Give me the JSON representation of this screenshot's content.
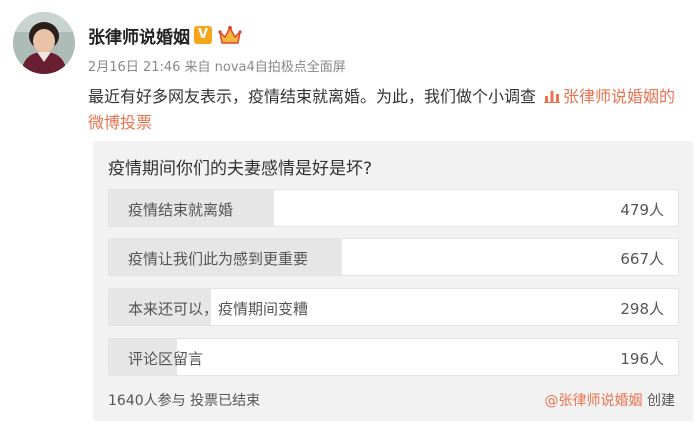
{
  "post": {
    "author_name": "张律师说婚姻",
    "verified_label": "V",
    "meta": "2月16日 21:46 来自 nova4自拍极点全面屏",
    "text": "最近有好多网友表示，疫情结束就离婚。为此，我们做个小调查",
    "poll_link_text": "张律师说婚姻的微博投票",
    "accent_color": "#eb7350"
  },
  "poll": {
    "question": "疫情期间你们的夫妻感情是好是坏?",
    "options": [
      {
        "label": "疫情结束就离婚",
        "count": "479人",
        "share": 0.29
      },
      {
        "label": "疫情让我们此为感到更重要",
        "count": "667人",
        "share": 0.41
      },
      {
        "label": "本来还可以，疫情期间变糟",
        "count": "298人",
        "share": 0.18
      },
      {
        "label": "评论区留言",
        "count": "196人",
        "share": 0.12
      }
    ],
    "status": "1640人参与 投票已结束",
    "creator_handle": "@张律师说婚姻",
    "creator_suffix": " 创建"
  }
}
